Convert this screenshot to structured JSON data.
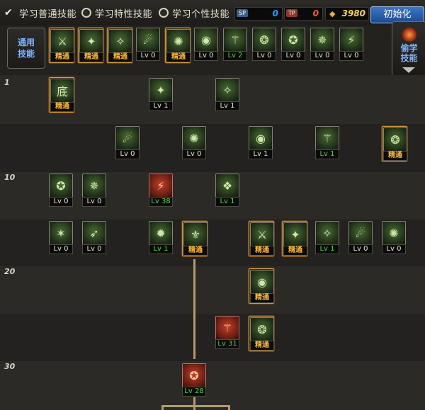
{
  "tabs": [
    {
      "label": "学习普通技能",
      "selected": true
    },
    {
      "label": "学习特性技能",
      "selected": false
    },
    {
      "label": "学习个性技能",
      "selected": false
    }
  ],
  "counters": [
    {
      "tag": "SP",
      "value": "0",
      "color": "#2aa0ff"
    },
    {
      "tag": "TP",
      "value": "0",
      "color": "#ff5a2a"
    }
  ],
  "gold": {
    "value": "3980"
  },
  "init_button": "初始化",
  "common": {
    "label_line1": "通用",
    "label_line2": "技能",
    "skills": [
      {
        "cap": "精通",
        "type": "master",
        "framed": true
      },
      {
        "cap": "精通",
        "type": "master",
        "framed": true
      },
      {
        "cap": "精通",
        "type": "master",
        "framed": true
      },
      {
        "cap": "Lv 0",
        "type": "lv0"
      },
      {
        "cap": "精通",
        "type": "master",
        "framed": true
      },
      {
        "cap": "Lv 0",
        "type": "lv0"
      },
      {
        "cap": "Lv 2",
        "type": "lvx"
      },
      {
        "cap": "Lv 0",
        "type": "lv0"
      },
      {
        "cap": "Lv 0",
        "type": "lv0"
      },
      {
        "cap": "Lv 0",
        "type": "lv0"
      },
      {
        "cap": "Lv 0",
        "type": "lv0"
      }
    ]
  },
  "steal_panel": {
    "line1": "偷学",
    "line2": "技能"
  },
  "levels": [
    "1",
    "10",
    "20",
    "30"
  ],
  "icon_text": {
    "base": "底"
  },
  "tree": [
    {
      "cap": "精通",
      "type": "master",
      "framed": true
    },
    {
      "cap": "Lv 1",
      "type": "lv0"
    },
    {
      "cap": "Lv 1",
      "type": "lv0"
    },
    {
      "cap": "Lv 0",
      "type": "lv0"
    },
    {
      "cap": "Lv 0",
      "type": "lv0"
    },
    {
      "cap": "Lv 1",
      "type": "lv0"
    },
    {
      "cap": "Lv 1",
      "type": "lvx"
    },
    {
      "cap": "精通",
      "type": "master",
      "framed": true
    },
    {
      "cap": "Lv 0",
      "type": "lv0"
    },
    {
      "cap": "Lv 0",
      "type": "lv0"
    },
    {
      "cap": "Lv 38",
      "type": "lvx"
    },
    {
      "cap": "Lv 1",
      "type": "lvx"
    },
    {
      "cap": "Lv 0",
      "type": "lv0"
    },
    {
      "cap": "Lv 0",
      "type": "lv0"
    },
    {
      "cap": "Lv 1",
      "type": "lvx"
    },
    {
      "cap": "精通",
      "type": "master",
      "framed": true
    },
    {
      "cap": "精通",
      "type": "master",
      "framed": true
    },
    {
      "cap": "精通",
      "type": "master",
      "framed": true
    },
    {
      "cap": "Lv 1",
      "type": "lvx"
    },
    {
      "cap": "Lv 0",
      "type": "lv0"
    },
    {
      "cap": "Lv 0",
      "type": "lv0"
    },
    {
      "cap": "精通",
      "type": "master",
      "framed": true
    },
    {
      "cap": "Lv 31",
      "type": "lvx"
    },
    {
      "cap": "精通",
      "type": "master",
      "framed": true
    },
    {
      "cap": "Lv 28",
      "type": "lvx"
    }
  ]
}
